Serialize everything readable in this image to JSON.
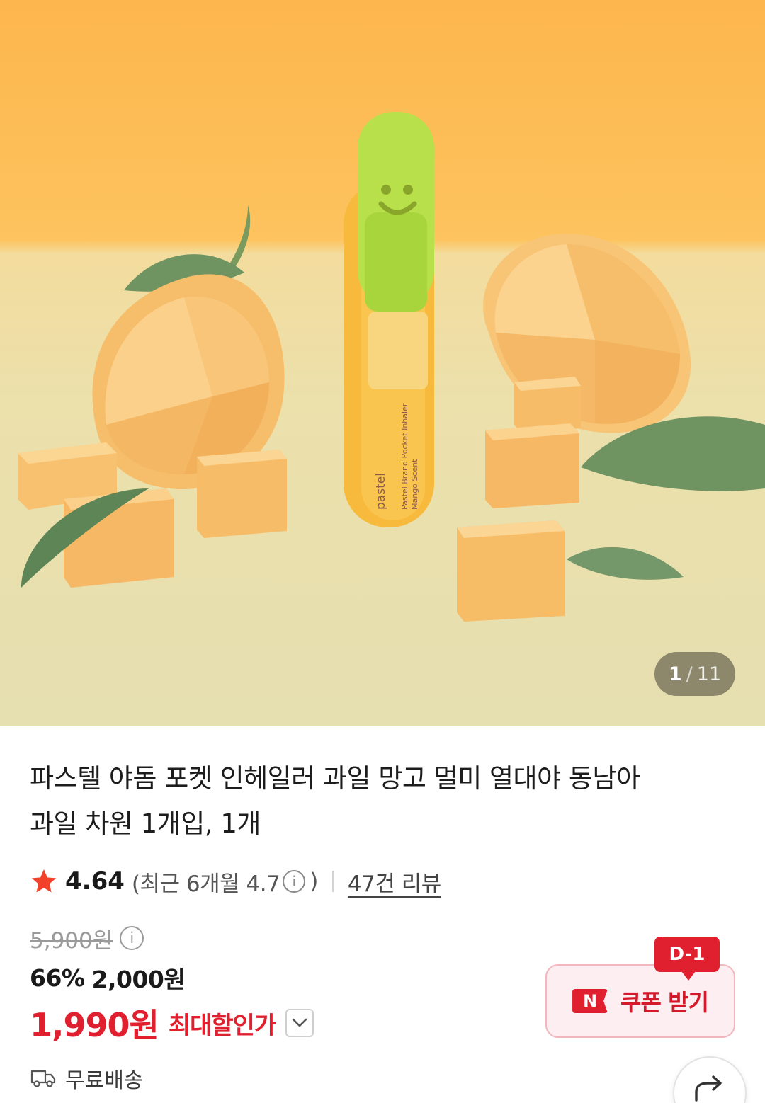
{
  "gallery": {
    "current": "1",
    "separator": "/",
    "total": "11",
    "image_text": {
      "brand": "pastel",
      "line1": "Pastel Brand Pocket Inhaler",
      "line2": "Mango Scent"
    }
  },
  "product": {
    "title_line1": "파스텔 야돔 포켓 인헤일러 과일 망고 멀미 열대야 동남아",
    "title_line2": "과일 차원 1개입, 1개"
  },
  "rating": {
    "score": "4.64",
    "recent_open": "(최근 6개월 4.7",
    "info_icon": "i",
    "recent_close": ")",
    "reviews": "47건 리뷰"
  },
  "price": {
    "original": "5,900원",
    "info_icon": "i",
    "discount_pct": "66%",
    "sale": "2,000원",
    "max_amount": "1,990원",
    "max_label": "최대할인가"
  },
  "coupon": {
    "badge": "N",
    "label": "쿠폰 받기",
    "dday": "D-1"
  },
  "delivery": {
    "label": "무료배송"
  },
  "colors": {
    "accent_red": "#e0202f",
    "hero_orange": "#fdb64d",
    "hero_floor": "#ece0ab"
  }
}
